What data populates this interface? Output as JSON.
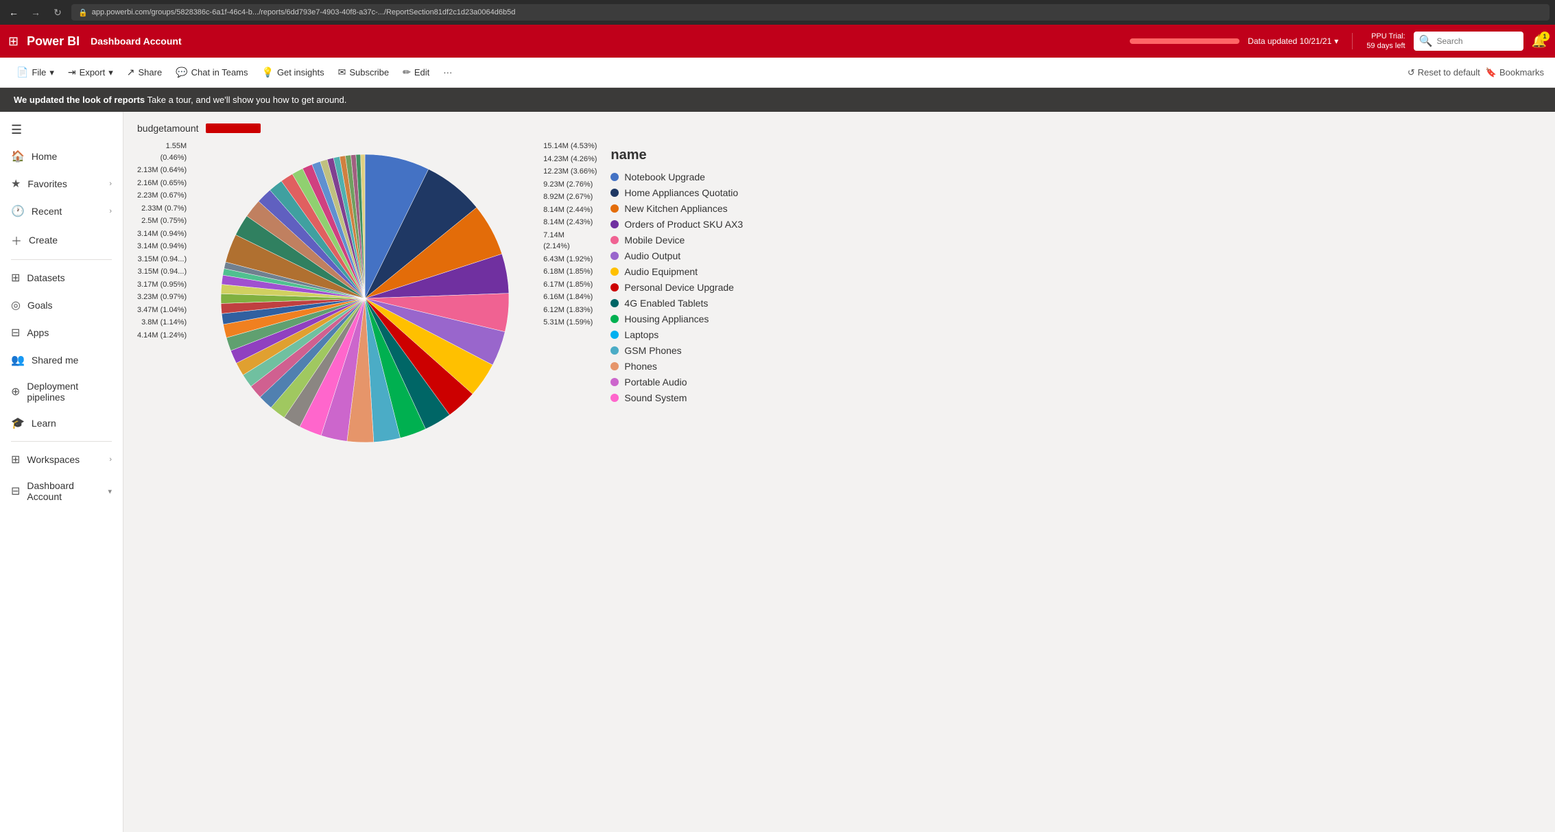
{
  "browser": {
    "url": "app.powerbi.com/groups/5828386c-6a1f-46c4-b.../reports/6dd793e7-4903-40f8-a37c-.../ReportSection81df2c1d23a0064d6b5d",
    "back_btn": "←",
    "forward_btn": "→",
    "refresh_btn": "↻"
  },
  "topnav": {
    "waffle": "⊞",
    "brand": "Power BI",
    "app_name": "Dashboard Account",
    "data_updated": "Data updated 10/21/21",
    "trial_line1": "PPU Trial:",
    "trial_line2": "59 days left",
    "search_placeholder": "Search",
    "notif_count": "1"
  },
  "toolbar": {
    "file_label": "File",
    "export_label": "Export",
    "share_label": "Share",
    "chat_label": "Chat in Teams",
    "insights_label": "Get insights",
    "subscribe_label": "Subscribe",
    "edit_label": "Edit",
    "more_label": "···",
    "reset_label": "Reset to default",
    "bookmarks_label": "Bookmarks"
  },
  "banner": {
    "bold_text": "We updated the look of reports",
    "rest_text": " Take a tour, and we'll show you how to get around."
  },
  "sidebar": {
    "hamburger": "☰",
    "items": [
      {
        "label": "Home",
        "icon": "🏠"
      },
      {
        "label": "Favorites",
        "icon": "★",
        "has_chevron": true
      },
      {
        "label": "Recent",
        "icon": "🕐",
        "has_chevron": true
      },
      {
        "label": "Create",
        "icon": "+",
        "is_create": true
      },
      {
        "label": "Datasets",
        "icon": "⊞"
      },
      {
        "label": "Goals",
        "icon": "◎"
      },
      {
        "label": "Apps",
        "icon": "⊟"
      },
      {
        "label": "Shared me",
        "icon": "👥"
      },
      {
        "label": "Deployment pipelines",
        "icon": "⊕"
      },
      {
        "label": "Learn",
        "icon": "🎓"
      },
      {
        "label": "Workspaces",
        "icon": "⊞",
        "has_chevron": true
      },
      {
        "label": "Dashboard Account",
        "icon": "⊟",
        "has_chevron": true
      }
    ]
  },
  "report": {
    "budget_label": "budgetamount",
    "pie_labels_left": [
      "2.13M (0.64%)",
      "2.16M (0.65%)",
      "2.23M (0.67%)",
      "2.33M (0.7%)",
      "2.5M (0.75%)",
      "3.14M (0.94%)",
      "3.14M (0.94%)",
      "3.15M (0.94...)",
      "3.15M (0.94...)",
      "3.17M (0.95%)",
      "3.23M (0.97%)",
      "3.47M (1.04%)",
      "3.8M (1.14%)",
      "4.14M (1.24%)"
    ],
    "pie_labels_top_left": [
      "1.55M",
      "(0.46%)",
      "2.13M (0.64%)"
    ],
    "pie_labels_right": [
      "15.14M (4.53%)",
      "14.23M (4.26%)",
      "12.23M (3.66%)",
      "9.23M (2.76%)",
      "8.92M (2.67%)",
      "8.14M (2.44%)",
      "8.14M (2.43%)",
      "7.14M",
      "(2.14%)",
      "6.43M (1.92%)",
      "6.18M (1.85%)",
      "6.17M (1.85%)",
      "6.16M (1.84%)",
      "6.12M (1.83%)",
      "5.31M (1.59%)"
    ]
  },
  "legend": {
    "title": "name",
    "items": [
      {
        "label": "Notebook Upgrade",
        "color": "#4472C4"
      },
      {
        "label": "Home Appliances Quotatio",
        "color": "#1F3864"
      },
      {
        "label": "New Kitchen Appliances",
        "color": "#E36C09"
      },
      {
        "label": "Orders of Product SKU AX3",
        "color": "#7030A0"
      },
      {
        "label": "Mobile Device",
        "color": "#F06292"
      },
      {
        "label": "Audio Output",
        "color": "#9966CC"
      },
      {
        "label": "Audio Equipment",
        "color": "#FFC000"
      },
      {
        "label": "Personal Device Upgrade",
        "color": "#CC0000"
      },
      {
        "label": "4G Enabled Tablets",
        "color": "#006666"
      },
      {
        "label": "Housing Appliances",
        "color": "#00B050"
      },
      {
        "label": "Laptops",
        "color": "#00B0F0"
      },
      {
        "label": "GSM Phones",
        "color": "#4BACC6"
      },
      {
        "label": "Phones",
        "color": "#E6956A"
      },
      {
        "label": "Portable Audio",
        "color": "#CC66CC"
      },
      {
        "label": "Sound System",
        "color": "#FF66CC"
      }
    ]
  },
  "pie_slices": [
    {
      "color": "#4472C4",
      "pct": 4.53
    },
    {
      "color": "#1F3864",
      "pct": 4.26
    },
    {
      "color": "#E36C09",
      "pct": 3.66
    },
    {
      "color": "#7030A0",
      "pct": 2.76
    },
    {
      "color": "#F06292",
      "pct": 2.67
    },
    {
      "color": "#9966CC",
      "pct": 2.44
    },
    {
      "color": "#FFC000",
      "pct": 2.43
    },
    {
      "color": "#CC0000",
      "pct": 2.14
    },
    {
      "color": "#006666",
      "pct": 1.92
    },
    {
      "color": "#00B050",
      "pct": 1.85
    },
    {
      "color": "#4BACC6",
      "pct": 1.85
    },
    {
      "color": "#E6956A",
      "pct": 1.84
    },
    {
      "color": "#CC66CC",
      "pct": 1.83
    },
    {
      "color": "#FF66CC",
      "pct": 1.59
    },
    {
      "color": "#8B8682",
      "pct": 1.24
    },
    {
      "color": "#a0c860",
      "pct": 1.14
    },
    {
      "color": "#5080b0",
      "pct": 1.04
    },
    {
      "color": "#d06090",
      "pct": 0.97
    },
    {
      "color": "#70c0a0",
      "pct": 0.95
    },
    {
      "color": "#e0a030",
      "pct": 0.94
    },
    {
      "color": "#9040c0",
      "pct": 0.94
    },
    {
      "color": "#60a070",
      "pct": 0.94
    },
    {
      "color": "#f08020",
      "pct": 0.94
    },
    {
      "color": "#3060a0",
      "pct": 0.75
    },
    {
      "color": "#c04040",
      "pct": 0.7
    },
    {
      "color": "#80b040",
      "pct": 0.67
    },
    {
      "color": "#d0d060",
      "pct": 0.65
    },
    {
      "color": "#a050d0",
      "pct": 0.64
    },
    {
      "color": "#50c090",
      "pct": 0.46
    },
    {
      "color": "#708090",
      "pct": 0.46
    },
    {
      "color": "#b07030",
      "pct": 2.0
    },
    {
      "color": "#308060",
      "pct": 1.5
    },
    {
      "color": "#c08060",
      "pct": 1.3
    },
    {
      "color": "#6060c0",
      "pct": 1.1
    },
    {
      "color": "#40a0a0",
      "pct": 1.0
    },
    {
      "color": "#e06060",
      "pct": 0.9
    },
    {
      "color": "#90d070",
      "pct": 0.8
    },
    {
      "color": "#d04080",
      "pct": 0.7
    },
    {
      "color": "#6090d0",
      "pct": 0.6
    },
    {
      "color": "#c0c080",
      "pct": 0.5
    },
    {
      "color": "#804090",
      "pct": 0.45
    },
    {
      "color": "#50b0b0",
      "pct": 0.43
    },
    {
      "color": "#d08040",
      "pct": 0.4
    },
    {
      "color": "#70a060",
      "pct": 0.38
    },
    {
      "color": "#a06080",
      "pct": 0.35
    },
    {
      "color": "#409060",
      "pct": 0.32
    },
    {
      "color": "#e0d080",
      "pct": 0.3
    }
  ]
}
